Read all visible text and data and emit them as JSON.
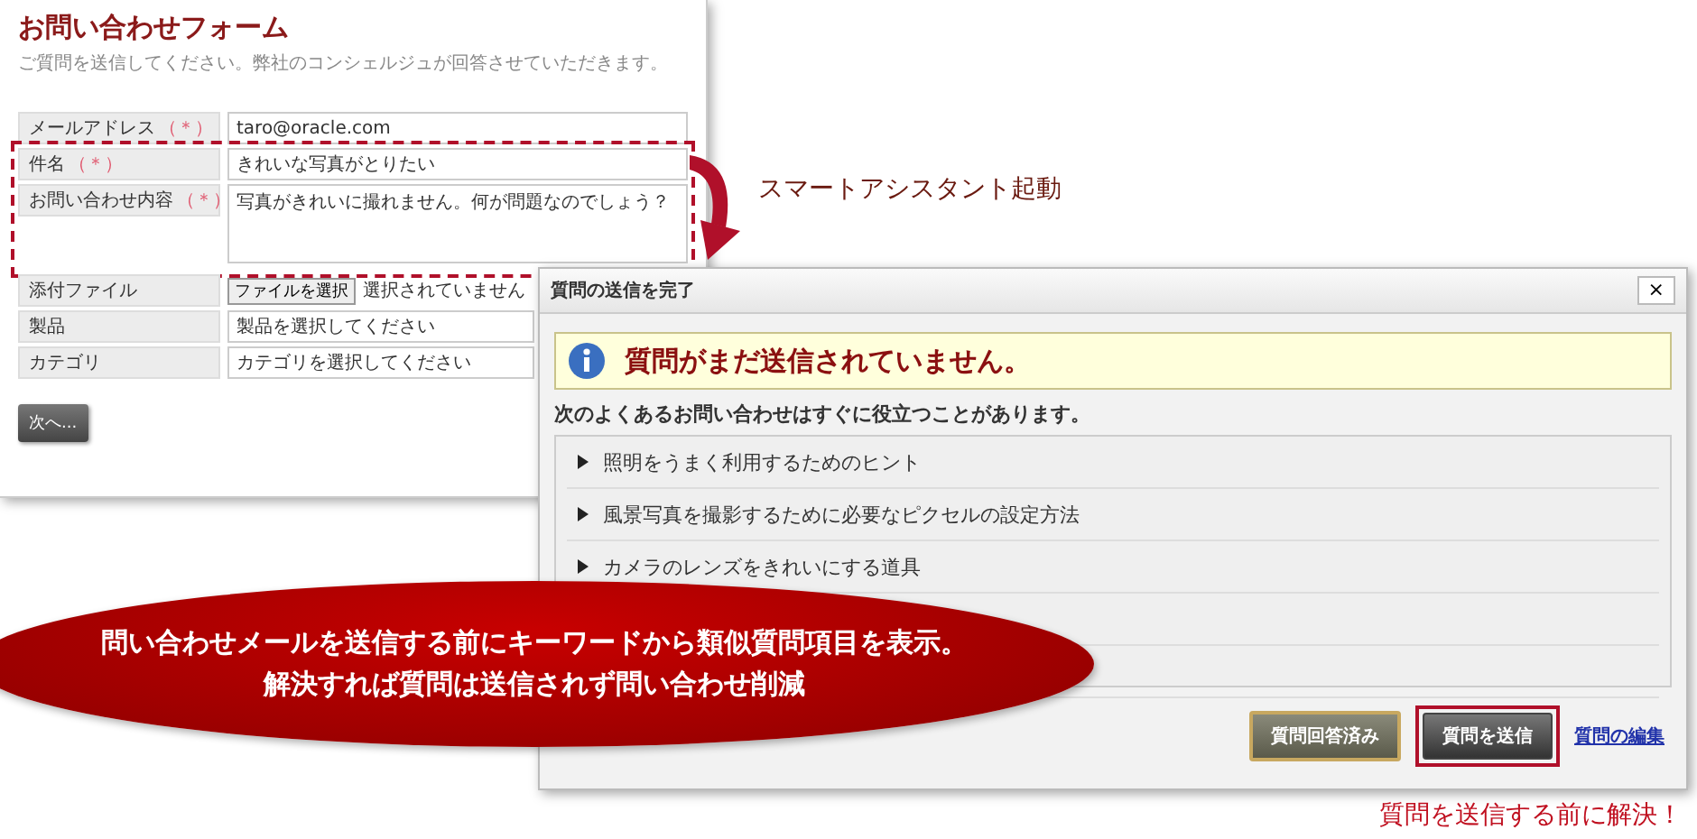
{
  "form": {
    "title": "お問い合わせフォーム",
    "subtitle": "ご質問を送信してください。弊社のコンシェルジュが回答させていただきます。",
    "fields": [
      {
        "kind": "text",
        "label": "メールアドレス",
        "required_mark": "（＊）",
        "value": "taro@oracle.com",
        "highlighted": false
      },
      {
        "kind": "text",
        "label": "件名",
        "required_mark": "（＊）",
        "value": "きれいな写真がとりたい",
        "highlighted": true
      },
      {
        "kind": "textarea",
        "label": "お問い合わせ内容",
        "required_mark": "（＊）",
        "value": "写真がきれいに撮れません。何が問題なのでしょう？",
        "highlighted": true
      },
      {
        "kind": "file",
        "label": "添付ファイル",
        "button_label": "ファイルを選択",
        "value": "選択されていません",
        "highlighted": false
      },
      {
        "kind": "select",
        "label": "製品",
        "value": "製品を選択してください",
        "highlighted": false
      },
      {
        "kind": "select",
        "label": "カテゴリ",
        "value": "カテゴリを選択してください",
        "highlighted": false
      }
    ],
    "next_button": "次へ..."
  },
  "callout": {
    "label": "スマートアシスタント起動"
  },
  "dialog": {
    "title": "質問の送信を完了",
    "close": "×",
    "alert": "質問がまだ送信されていません。",
    "intro": "次のよくあるお問い合わせはすぐに役立つことがあります。",
    "faqs": [
      "照明をうまく利用するためのヒント",
      "風景写真を撮影するために必要なピクセルの設定方法",
      "カメラのレンズをきれいにする道具"
    ],
    "buttons": [
      {
        "label": "質問回答済み",
        "kind": "answered",
        "highlighted": false
      },
      {
        "label": "質問を送信",
        "kind": "send",
        "highlighted": true
      }
    ],
    "edit_link": "質問の編集"
  },
  "banner": {
    "lines": [
      "問い合わせメールを送信する前にキーワードから類似質問項目を表示。",
      "解決すれば質問は送信されず問い合わせ削減"
    ]
  },
  "note": "質問を送信する前に解決！"
}
